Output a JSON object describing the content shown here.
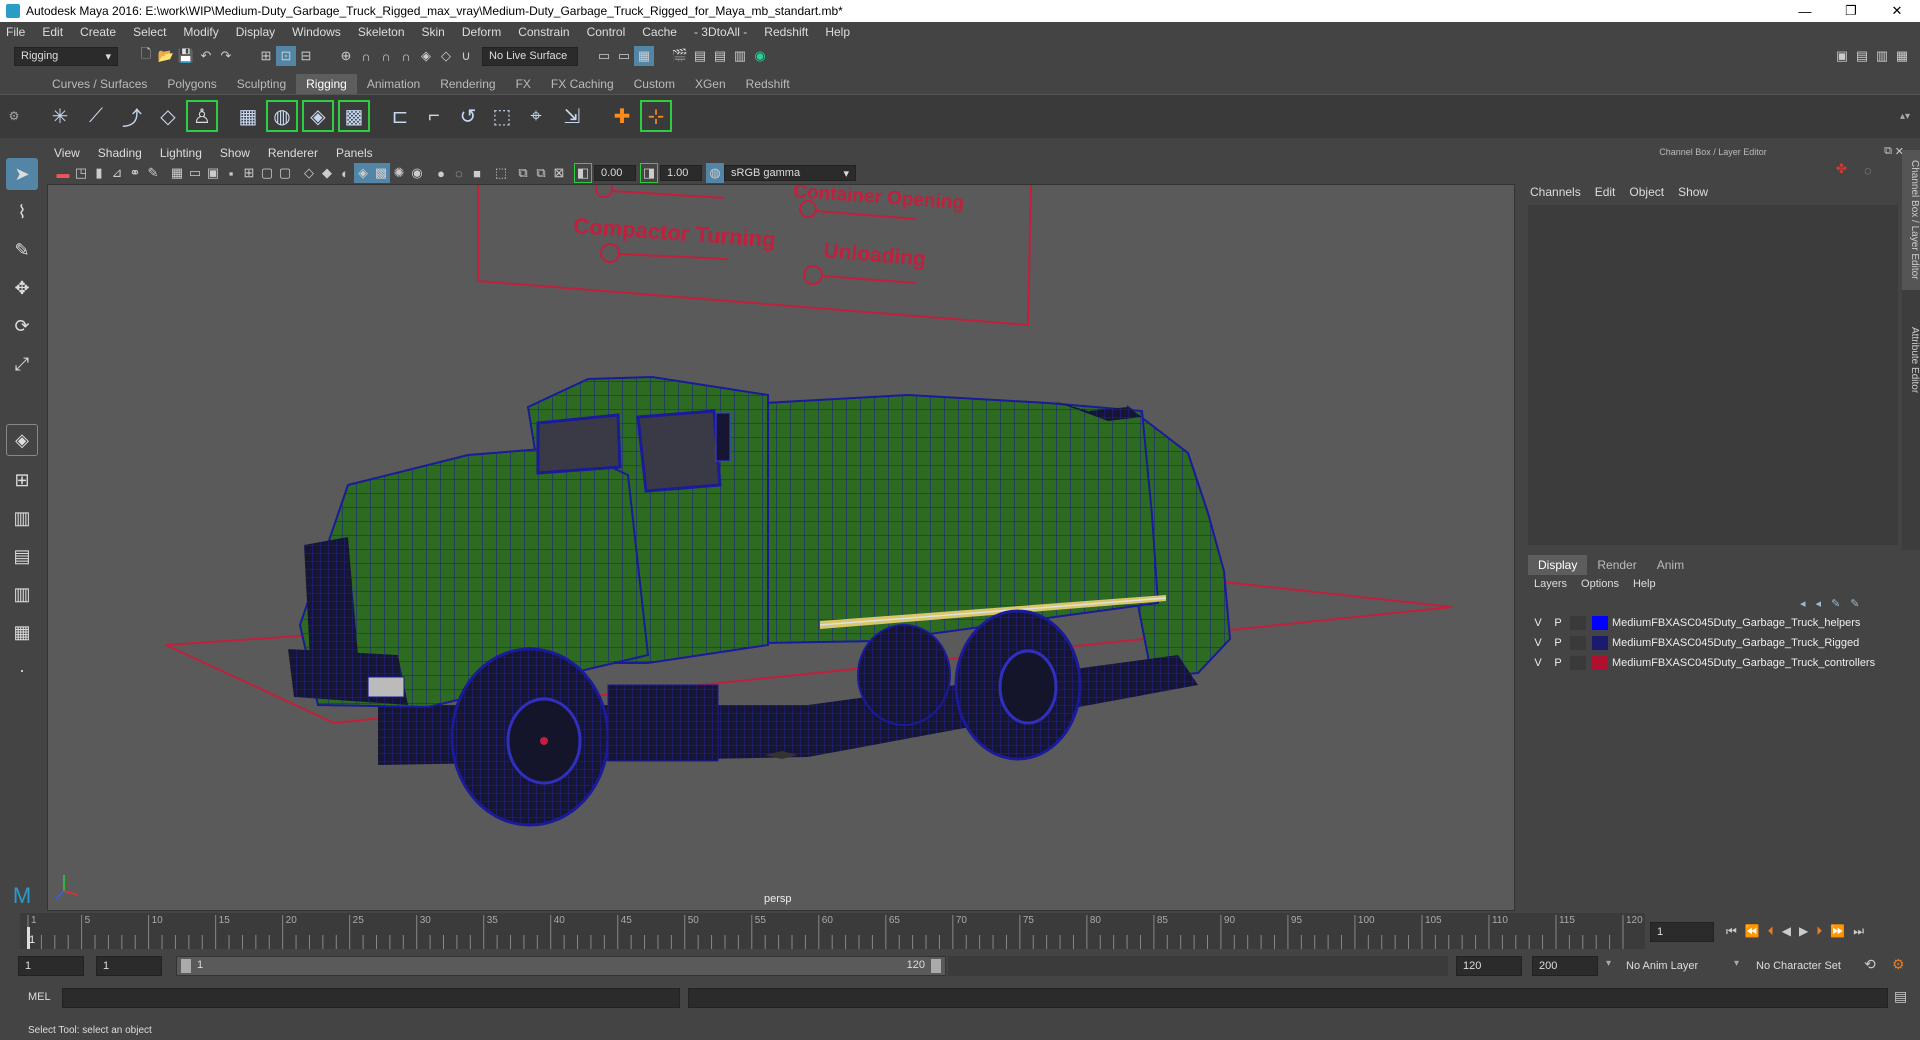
{
  "window": {
    "title": "Autodesk Maya 2016: E:\\work\\WIP\\Medium-Duty_Garbage_Truck_Rigged_max_vray\\Medium-Duty_Garbage_Truck_Rigged_for_Maya_mb_standart.mb*",
    "minimize": "—",
    "maximize": "❐",
    "close": "✕"
  },
  "menubar": [
    "File",
    "Edit",
    "Create",
    "Select",
    "Modify",
    "Display",
    "Windows",
    "Skeleton",
    "Skin",
    "Deform",
    "Constrain",
    "Control",
    "Cache",
    "- 3DtoAll -",
    "Redshift",
    "Help"
  ],
  "statusline": {
    "menuset": "Rigging",
    "live_surface": "No Live Surface"
  },
  "shelf_tabs": [
    "Curves / Surfaces",
    "Polygons",
    "Sculpting",
    "Rigging",
    "Animation",
    "Rendering",
    "FX",
    "FX Caching",
    "Custom",
    "XGen",
    "Redshift"
  ],
  "shelf_active": "Rigging",
  "viewport": {
    "menu": [
      "View",
      "Shading",
      "Lighting",
      "Show",
      "Renderer",
      "Panels"
    ],
    "exposure": "0.00",
    "gamma": "1.00",
    "color_space": "sRGB gamma",
    "camera_label": "persp",
    "control_labels": {
      "top": "Container Opening",
      "compactor": "Compactor Turning",
      "unloading": "Unloading"
    }
  },
  "channel_box": {
    "title": "Channel Box / Layer Editor",
    "menu": [
      "Channels",
      "Edit",
      "Object",
      "Show"
    ]
  },
  "layer_editor": {
    "tabs": [
      "Display",
      "Render",
      "Anim"
    ],
    "active_tab": "Display",
    "menu": [
      "Layers",
      "Options",
      "Help"
    ],
    "layers": [
      {
        "v": "V",
        "p": "P",
        "name": "MediumFBXASC045Duty_Garbage_Truck_helpers",
        "color": "#0000ff"
      },
      {
        "v": "V",
        "p": "P",
        "name": "MediumFBXASC045Duty_Garbage_Truck_Rigged",
        "color": "#1a1a6e"
      },
      {
        "v": "V",
        "p": "P",
        "name": "MediumFBXASC045Duty_Garbage_Truck_controllers",
        "color": "#b01030"
      }
    ]
  },
  "side_tabs": [
    "Channel Box / Layer Editor",
    "Attribute Editor"
  ],
  "timeline": {
    "ticks": [
      "1",
      "5",
      "10",
      "15",
      "20",
      "25",
      "30",
      "35",
      "40",
      "45",
      "50",
      "55",
      "60",
      "65",
      "70",
      "75",
      "80",
      "85",
      "90",
      "95",
      "100",
      "105",
      "110",
      "115",
      "120"
    ],
    "current_frame": "1"
  },
  "range": {
    "start": "1",
    "playback_start": "1",
    "slider_start": "1",
    "slider_end": "120",
    "playback_end": "120",
    "end": "200",
    "anim_layer": "No Anim Layer",
    "character_set": "No Character Set"
  },
  "cmdline": {
    "label": "MEL"
  },
  "helpline": "Select Tool: select an object",
  "colors": {
    "accent": "#5285a6",
    "truck_green": "#2e6b22",
    "wire_blue": "#1a1a9a",
    "control_red": "#c0203c"
  }
}
